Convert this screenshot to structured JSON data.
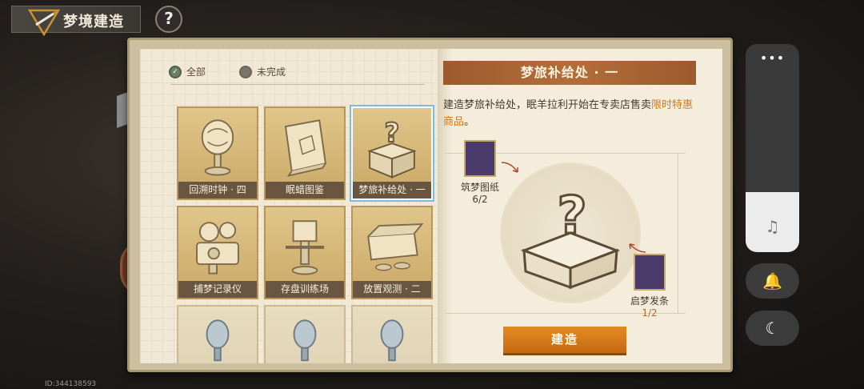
{
  "header": {
    "title": "梦境建造",
    "help_label": "?"
  },
  "filters": [
    {
      "label": "全部",
      "checked": true
    },
    {
      "label": "未完成",
      "checked": false
    }
  ],
  "grid_items": [
    {
      "label": "回溯时钟 · 四",
      "art": "clock-trophy-icon",
      "selected": false
    },
    {
      "label": "眠蜡图鉴",
      "art": "book-icon",
      "selected": false
    },
    {
      "label": "梦旅补给处 · 一",
      "art": "mystery-box-icon",
      "selected": true
    },
    {
      "label": "捕梦记录仪",
      "art": "camera-icon",
      "selected": false
    },
    {
      "label": "存盘训练场",
      "art": "training-dummy-icon",
      "selected": false
    },
    {
      "label": "放置观测 · 二",
      "art": "treasure-chest-icon",
      "selected": false
    },
    {
      "label": "",
      "art": "orb-trophy-icon",
      "selected": false
    },
    {
      "label": "",
      "art": "orb-trophy-icon",
      "selected": false
    },
    {
      "label": "",
      "art": "orb-trophy-icon",
      "selected": false
    }
  ],
  "detail": {
    "title": "梦旅补给处 · 一",
    "desc_prefix": "建造梦旅补给处，眠羊拉利开始在专卖店售卖",
    "desc_highlight": "限时特惠商品",
    "desc_suffix": "。",
    "materials": [
      {
        "name": "筑梦图纸",
        "count": "6/2",
        "icon": "blueprint-icon"
      },
      {
        "name": "启梦发条",
        "count": "1/2",
        "icon": "key-icon"
      }
    ],
    "build_label": "建造"
  },
  "side_panel": {
    "menu_label": "•••",
    "music_icon": "♫",
    "bell_icon": "🔔",
    "moon_icon": "☾"
  },
  "footer_id": "ID:344138593",
  "colors": {
    "accent_orange": "#d57a1a",
    "header_brown": "#a8622f",
    "card_gold": "#d6b776"
  }
}
